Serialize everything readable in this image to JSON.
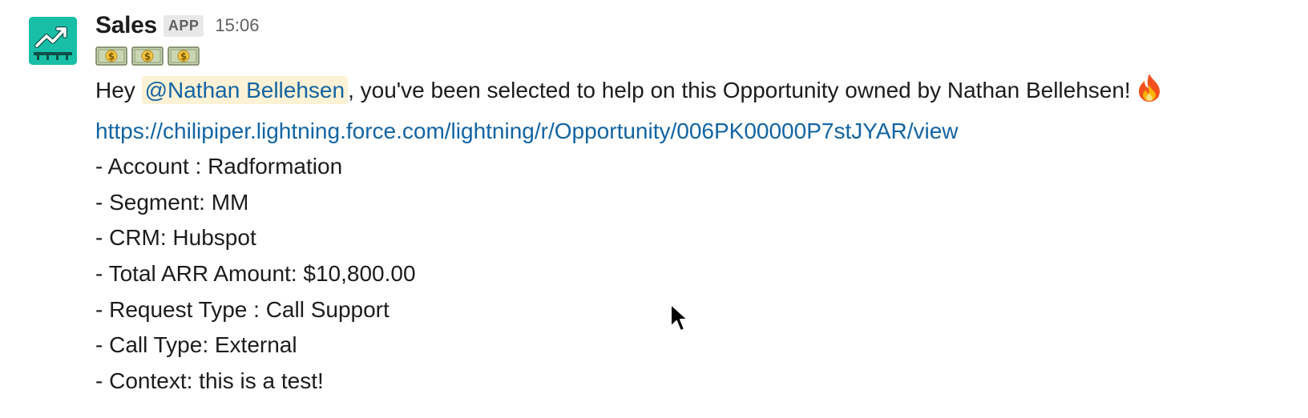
{
  "message": {
    "sender": "Sales",
    "badge": "APP",
    "time": "15:06",
    "money_emoji_count": 3,
    "greeting_prefix": "Hey ",
    "mention": "@Nathan Bellehsen",
    "greeting_suffix": ", you've been selected to help on this Opportunity owned by Nathan Bellehsen!",
    "link": "https://chilipiper.lightning.force.com/lightning/r/Opportunity/006PK00000P7stJYAR/view",
    "details": [
      "- Account : Radformation",
      "- Segment: MM",
      "- CRM: Hubspot",
      "- Total ARR Amount: $10,800.00",
      "- Request Type : Call Support",
      "- Call Type: External",
      "- Context: this is a test!"
    ]
  },
  "icons": {
    "avatar": "trending-up-chart-icon",
    "money": "dollar-banknote-icon",
    "fire": "fire-icon",
    "cursor": "mouse-pointer-icon"
  },
  "colors": {
    "avatar": "#1cc4ab",
    "link": "#1264a3",
    "mention_bg": "#fdf1d6"
  }
}
